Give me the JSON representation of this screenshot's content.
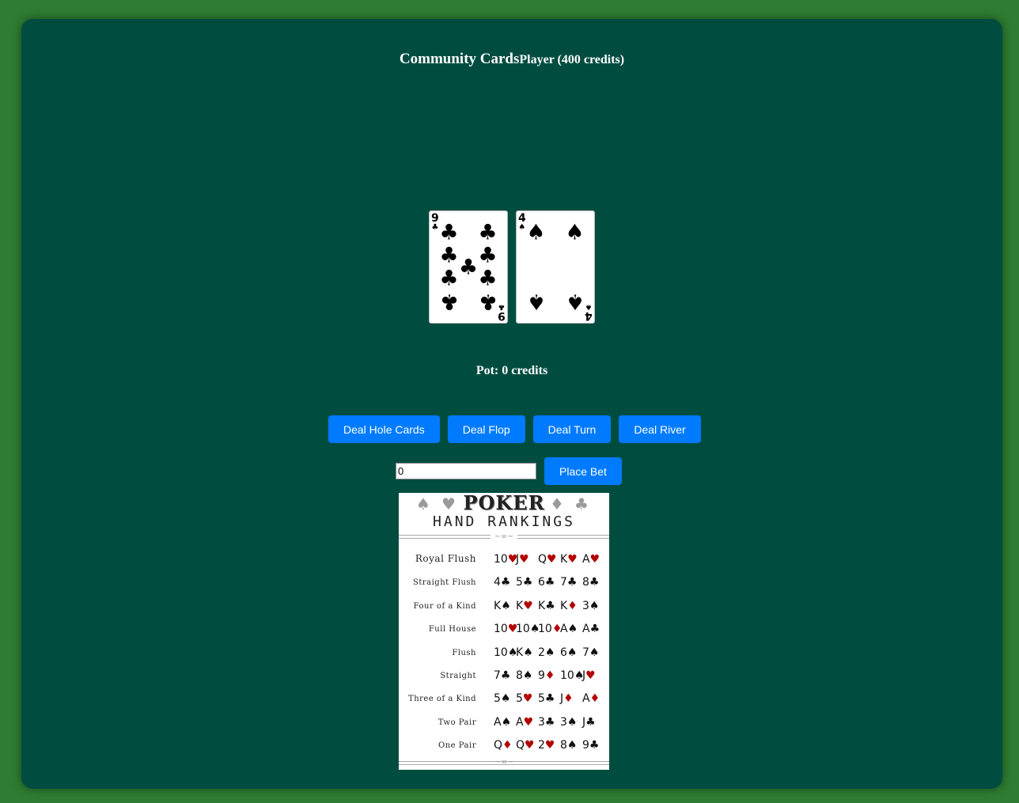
{
  "header": {
    "community_label": "Community Cards",
    "player_label": "Player (400 credits)"
  },
  "player_hand": [
    {
      "rank": "9",
      "suit": "♣",
      "suit_name": "clubs"
    },
    {
      "rank": "4",
      "suit": "♠",
      "suit_name": "spades"
    }
  ],
  "pot_label": "Pot: 0 credits",
  "buttons": {
    "deal_hole": "Deal Hole Cards",
    "deal_flop": "Deal Flop",
    "deal_turn": "Deal Turn",
    "deal_river": "Deal River",
    "place_bet": "Place Bet"
  },
  "bet_input": {
    "value": "0"
  },
  "rankings": {
    "title": "POKER",
    "subtitle": "HAND RANKINGS",
    "hands": [
      {
        "name": "Royal Flush",
        "cards": [
          [
            "10",
            "♥"
          ],
          [
            "J",
            "♥"
          ],
          [
            "Q",
            "♥"
          ],
          [
            "K",
            "♥"
          ],
          [
            "A",
            "♥"
          ]
        ]
      },
      {
        "name": "Straight Flush",
        "cards": [
          [
            "4",
            "♣"
          ],
          [
            "5",
            "♣"
          ],
          [
            "6",
            "♣"
          ],
          [
            "7",
            "♣"
          ],
          [
            "8",
            "♣"
          ]
        ]
      },
      {
        "name": "Four of a Kind",
        "cards": [
          [
            "K",
            "♠"
          ],
          [
            "K",
            "♥"
          ],
          [
            "K",
            "♣"
          ],
          [
            "K",
            "♦"
          ],
          [
            "3",
            "♠"
          ]
        ]
      },
      {
        "name": "Full House",
        "cards": [
          [
            "10",
            "♥"
          ],
          [
            "10",
            "♠"
          ],
          [
            "10",
            "♦"
          ],
          [
            "A",
            "♠"
          ],
          [
            "A",
            "♣"
          ]
        ]
      },
      {
        "name": "Flush",
        "cards": [
          [
            "10",
            "♠"
          ],
          [
            "K",
            "♠"
          ],
          [
            "2",
            "♠"
          ],
          [
            "6",
            "♠"
          ],
          [
            "7",
            "♠"
          ]
        ]
      },
      {
        "name": "Straight",
        "cards": [
          [
            "7",
            "♣"
          ],
          [
            "8",
            "♠"
          ],
          [
            "9",
            "♦"
          ],
          [
            "10",
            "♠"
          ],
          [
            "J",
            "♥"
          ]
        ]
      },
      {
        "name": "Three of a Kind",
        "cards": [
          [
            "5",
            "♠"
          ],
          [
            "5",
            "♥"
          ],
          [
            "5",
            "♣"
          ],
          [
            "J",
            "♦"
          ],
          [
            "A",
            "♦"
          ]
        ]
      },
      {
        "name": "Two Pair",
        "cards": [
          [
            "A",
            "♠"
          ],
          [
            "A",
            "♥"
          ],
          [
            "3",
            "♣"
          ],
          [
            "3",
            "♠"
          ],
          [
            "J",
            "♣"
          ]
        ]
      },
      {
        "name": "One Pair",
        "cards": [
          [
            "Q",
            "♦"
          ],
          [
            "Q",
            "♥"
          ],
          [
            "2",
            "♥"
          ],
          [
            "8",
            "♠"
          ],
          [
            "9",
            "♣"
          ]
        ]
      }
    ]
  },
  "colors": {
    "page_bg": "#2e7d32",
    "table_bg": "#004d40",
    "button_bg": "#007bff",
    "red_suit": "#b30000"
  }
}
